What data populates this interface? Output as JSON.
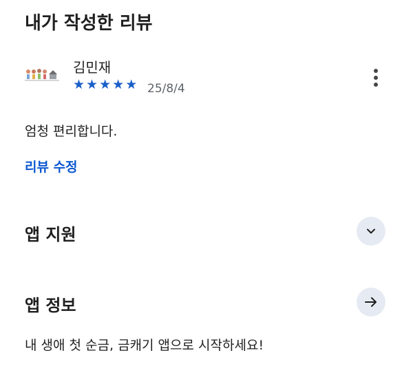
{
  "my_review": {
    "title": "내가 작성한 리뷰",
    "reviewer_name": "김민재",
    "rating": 5,
    "rating_max": 5,
    "date": "25/8/4",
    "text": "엄청 편리합니다.",
    "edit_label": "리뷰 수정",
    "star_color": "#1a5fc9"
  },
  "app_support": {
    "title": "앱 지원",
    "icon": "chevron-down-icon"
  },
  "app_info": {
    "title": "앱 정보",
    "icon": "arrow-right-icon",
    "description": "내 생애 첫 순금, 금캐기 앱으로 시작하세요!"
  },
  "colors": {
    "accent": "#0b57d0",
    "button_bg": "#e6eaf2"
  }
}
